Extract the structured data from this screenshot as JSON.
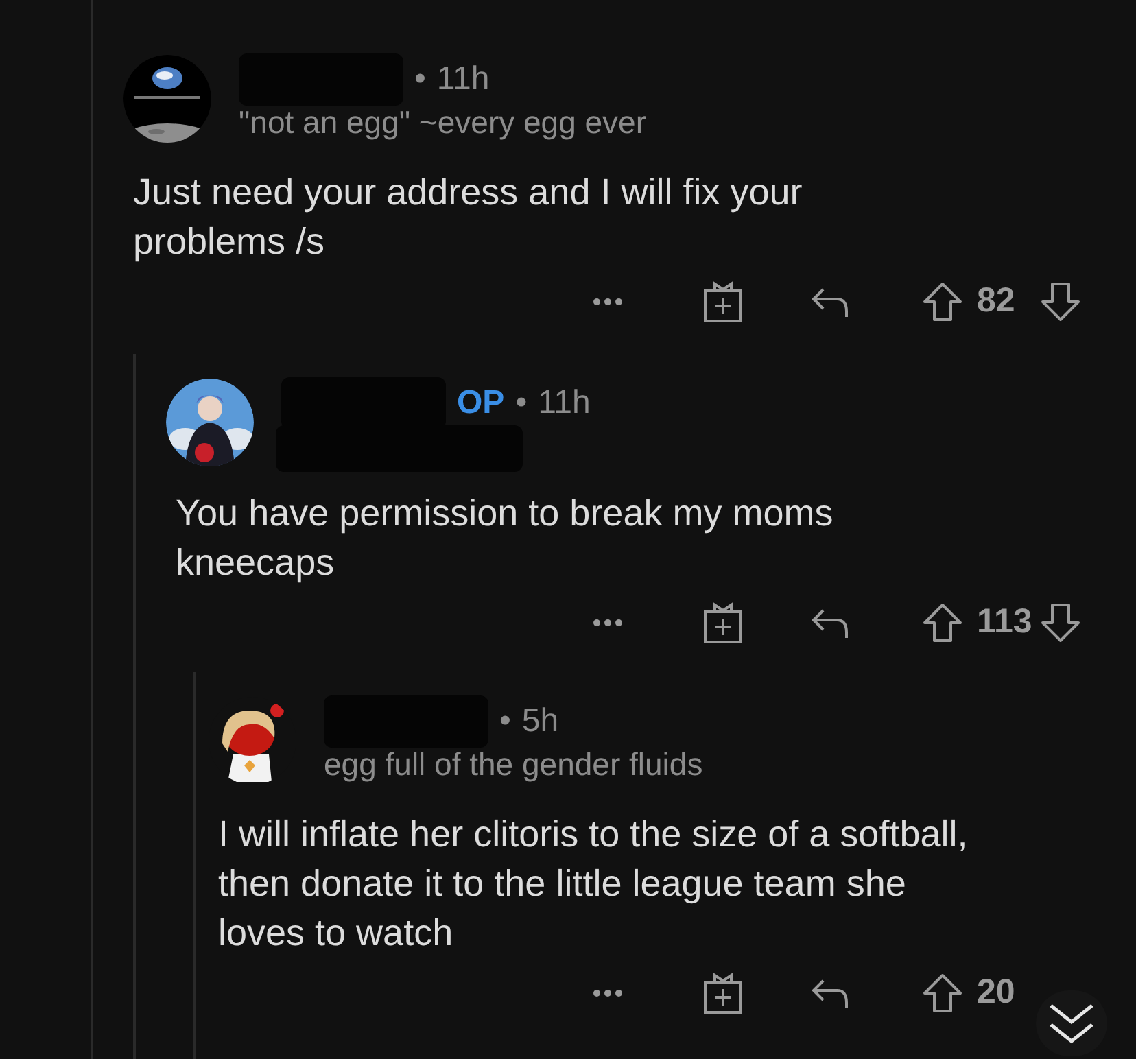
{
  "comments": [
    {
      "separator": "•",
      "time": "11h",
      "flair": "\"not an egg\" ~every egg ever",
      "body": "Just need your address and I will fix your problems /s",
      "score": "82",
      "downvote_visible": true
    },
    {
      "separator": "•",
      "badge": "OP",
      "time": "11h",
      "body": "You have permission to break my moms kneecaps",
      "score": "113",
      "downvote_visible": true
    },
    {
      "separator": "•",
      "time": "5h",
      "flair": "egg full of the gender fluids",
      "body": "I will inflate her clitoris to the size of a softball, then donate it to the little league team she loves to watch",
      "score": "20",
      "downvote_visible": false
    }
  ],
  "scroll_down_button": true
}
